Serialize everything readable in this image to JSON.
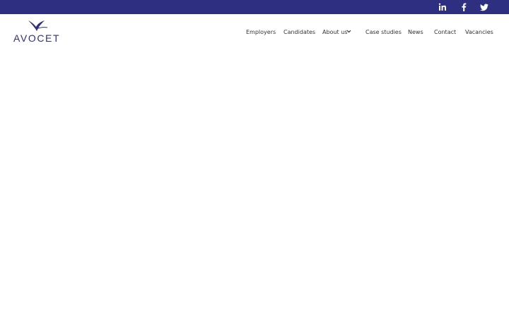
{
  "brand": {
    "name": "AVOCET",
    "primary_color": "#2e2f80",
    "logo_icon": "avocet-bird-icon"
  },
  "social": [
    {
      "name": "LinkedIn",
      "icon": "linkedin-icon",
      "glyph": "in"
    },
    {
      "name": "Facebook",
      "icon": "facebook-icon",
      "glyph": "f"
    },
    {
      "name": "Twitter",
      "icon": "twitter-icon",
      "glyph": ""
    }
  ],
  "nav": {
    "employers": "Employers",
    "candidates": "Candidates",
    "about": "About us",
    "case_studies": "Case studies",
    "news": "News",
    "contact": "Contact",
    "vacancies": "Vacancies"
  }
}
